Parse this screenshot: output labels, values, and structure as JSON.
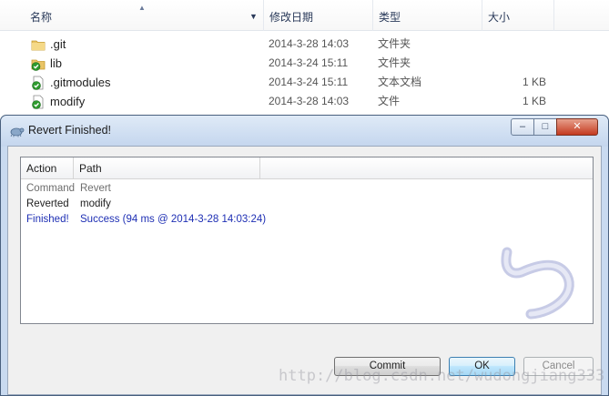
{
  "explorer": {
    "columns": {
      "name": "名称",
      "modified": "修改日期",
      "type": "类型",
      "size": "大小"
    },
    "files": [
      {
        "name": ".git",
        "modified": "2014-3-28 14:03",
        "type": "文件夹",
        "size": "",
        "icon": "folder-icon"
      },
      {
        "name": "lib",
        "modified": "2014-3-24 15:11",
        "type": "文件夹",
        "size": "",
        "icon": "folder-ok-overlay-icon"
      },
      {
        "name": ".gitmodules",
        "modified": "2014-3-24 15:11",
        "type": "文本文档",
        "size": "1 KB",
        "icon": "file-ok-overlay-icon"
      },
      {
        "name": "modify",
        "modified": "2014-3-28 14:03",
        "type": "文件",
        "size": "1 KB",
        "icon": "file-ok-overlay-icon"
      }
    ]
  },
  "dialog": {
    "title": "Revert Finished!",
    "window_buttons": {
      "minimize": "–",
      "maximize": "□",
      "close": "✕"
    },
    "list": {
      "headers": {
        "action": "Action",
        "path": "Path"
      },
      "rows": [
        {
          "action": "Command",
          "path": "Revert",
          "color": "#6d6d6d"
        },
        {
          "action": "Reverted",
          "path": "modify",
          "color": "#1e1e1e"
        },
        {
          "action": "Finished!",
          "path": "Success (94 ms @ 2014-3-28 14:03:24)",
          "color": "#1e2fb4"
        }
      ]
    },
    "buttons": {
      "commit": "Commit",
      "ok": "OK",
      "cancel": "Cancel"
    }
  },
  "watermark": "http://blog.csdn.net/wudongjiang333"
}
